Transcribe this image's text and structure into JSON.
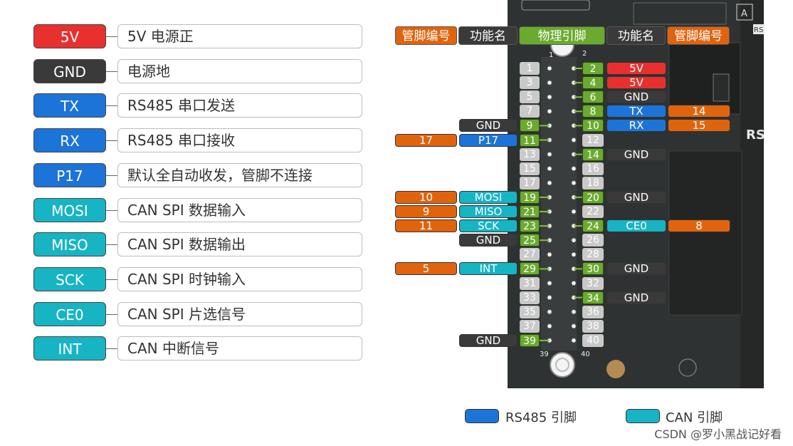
{
  "colors": {
    "power": "#e8312f",
    "ground": "#3a3a3a",
    "rs485": "#1d74d8",
    "can": "#17b4c4",
    "physical": "#6aaa2e",
    "pin_number": "#e0640e",
    "inactive": "#c9c9c9"
  },
  "legend": [
    {
      "tag": "5V",
      "desc": "5V 电源正",
      "color": "#e8312f"
    },
    {
      "tag": "GND",
      "desc": "电源地",
      "color": "#3a3a3a"
    },
    {
      "tag": "TX",
      "desc": "RS485 串口发送",
      "color": "#1d74d8"
    },
    {
      "tag": "RX",
      "desc": "RS485 串口接收",
      "color": "#1d74d8"
    },
    {
      "tag": "P17",
      "desc": "默认全自动收发，管脚不连接",
      "color": "#1d74d8"
    },
    {
      "tag": "MOSI",
      "desc": "CAN SPI 数据输入",
      "color": "#17b4c4"
    },
    {
      "tag": "MISO",
      "desc": "CAN SPI 数据输出",
      "color": "#17b4c4"
    },
    {
      "tag": "SCK",
      "desc": "CAN SPI 时钟输入",
      "color": "#17b4c4"
    },
    {
      "tag": "CE0",
      "desc": "CAN SPI 片选信号",
      "color": "#17b4c4"
    },
    {
      "tag": "INT",
      "desc": "CAN 中断信号",
      "color": "#17b4c4"
    }
  ],
  "headers": {
    "left_pin_no": "管脚编号",
    "left_func": "功能名",
    "physical": "物理引脚",
    "right_func": "功能名",
    "right_pin_no": "管脚编号"
  },
  "pins": [
    {
      "physical": "1",
      "active": false,
      "func": "",
      "func_color": "",
      "gpio": ""
    },
    {
      "physical": "2",
      "active": true,
      "func": "5V",
      "func_color": "#e8312f",
      "gpio": ""
    },
    {
      "physical": "3",
      "active": false,
      "func": "",
      "func_color": "",
      "gpio": ""
    },
    {
      "physical": "4",
      "active": true,
      "func": "5V",
      "func_color": "#e8312f",
      "gpio": ""
    },
    {
      "physical": "5",
      "active": false,
      "func": "",
      "func_color": "",
      "gpio": ""
    },
    {
      "physical": "6",
      "active": true,
      "func": "GND",
      "func_color": "#3a3a3a",
      "gpio": ""
    },
    {
      "physical": "7",
      "active": false,
      "func": "",
      "func_color": "",
      "gpio": ""
    },
    {
      "physical": "8",
      "active": true,
      "func": "TX",
      "func_color": "#1d74d8",
      "gpio": "14"
    },
    {
      "physical": "9",
      "active": true,
      "func": "GND",
      "func_color": "#3a3a3a",
      "gpio": ""
    },
    {
      "physical": "10",
      "active": true,
      "func": "RX",
      "func_color": "#1d74d8",
      "gpio": "15"
    },
    {
      "physical": "11",
      "active": true,
      "func": "P17",
      "func_color": "#1d74d8",
      "gpio": "17"
    },
    {
      "physical": "12",
      "active": false,
      "func": "",
      "func_color": "",
      "gpio": ""
    },
    {
      "physical": "13",
      "active": false,
      "func": "",
      "func_color": "",
      "gpio": ""
    },
    {
      "physical": "14",
      "active": true,
      "func": "GND",
      "func_color": "#3a3a3a",
      "gpio": ""
    },
    {
      "physical": "15",
      "active": false,
      "func": "",
      "func_color": "",
      "gpio": ""
    },
    {
      "physical": "16",
      "active": false,
      "func": "",
      "func_color": "",
      "gpio": ""
    },
    {
      "physical": "17",
      "active": false,
      "func": "",
      "func_color": "",
      "gpio": ""
    },
    {
      "physical": "18",
      "active": false,
      "func": "",
      "func_color": "",
      "gpio": ""
    },
    {
      "physical": "19",
      "active": true,
      "func": "MOSI",
      "func_color": "#17b4c4",
      "gpio": "10"
    },
    {
      "physical": "20",
      "active": true,
      "func": "GND",
      "func_color": "#3a3a3a",
      "gpio": ""
    },
    {
      "physical": "21",
      "active": true,
      "func": "MISO",
      "func_color": "#17b4c4",
      "gpio": "9"
    },
    {
      "physical": "22",
      "active": false,
      "func": "",
      "func_color": "",
      "gpio": ""
    },
    {
      "physical": "23",
      "active": true,
      "func": "SCK",
      "func_color": "#17b4c4",
      "gpio": "11"
    },
    {
      "physical": "24",
      "active": true,
      "func": "CE0",
      "func_color": "#17b4c4",
      "gpio": "8"
    },
    {
      "physical": "25",
      "active": true,
      "func": "GND",
      "func_color": "#3a3a3a",
      "gpio": ""
    },
    {
      "physical": "26",
      "active": false,
      "func": "",
      "func_color": "",
      "gpio": ""
    },
    {
      "physical": "27",
      "active": false,
      "func": "",
      "func_color": "",
      "gpio": ""
    },
    {
      "physical": "28",
      "active": false,
      "func": "",
      "func_color": "",
      "gpio": ""
    },
    {
      "physical": "29",
      "active": true,
      "func": "INT",
      "func_color": "#17b4c4",
      "gpio": "5"
    },
    {
      "physical": "30",
      "active": true,
      "func": "GND",
      "func_color": "#3a3a3a",
      "gpio": ""
    },
    {
      "physical": "31",
      "active": false,
      "func": "",
      "func_color": "",
      "gpio": ""
    },
    {
      "physical": "32",
      "active": false,
      "func": "",
      "func_color": "",
      "gpio": ""
    },
    {
      "physical": "33",
      "active": false,
      "func": "",
      "func_color": "",
      "gpio": ""
    },
    {
      "physical": "34",
      "active": true,
      "func": "GND",
      "func_color": "#3a3a3a",
      "gpio": ""
    },
    {
      "physical": "35",
      "active": false,
      "func": "",
      "func_color": "",
      "gpio": ""
    },
    {
      "physical": "36",
      "active": false,
      "func": "",
      "func_color": "",
      "gpio": ""
    },
    {
      "physical": "37",
      "active": false,
      "func": "",
      "func_color": "",
      "gpio": ""
    },
    {
      "physical": "38",
      "active": false,
      "func": "",
      "func_color": "",
      "gpio": ""
    },
    {
      "physical": "39",
      "active": true,
      "func": "GND",
      "func_color": "#3a3a3a",
      "gpio": ""
    },
    {
      "physical": "40",
      "active": false,
      "func": "",
      "func_color": "",
      "gpio": ""
    }
  ],
  "board": {
    "corner_label_1": "1",
    "corner_label_2": "2",
    "corner_label_39": "39",
    "corner_label_40": "40",
    "side_text": "RS",
    "badge_a": "A",
    "badge_rs": "RS"
  },
  "footer": {
    "rs485_key": "RS485 引脚",
    "can_key": "CAN 引脚",
    "watermark": "CSDN @罗小黑战记好看"
  }
}
